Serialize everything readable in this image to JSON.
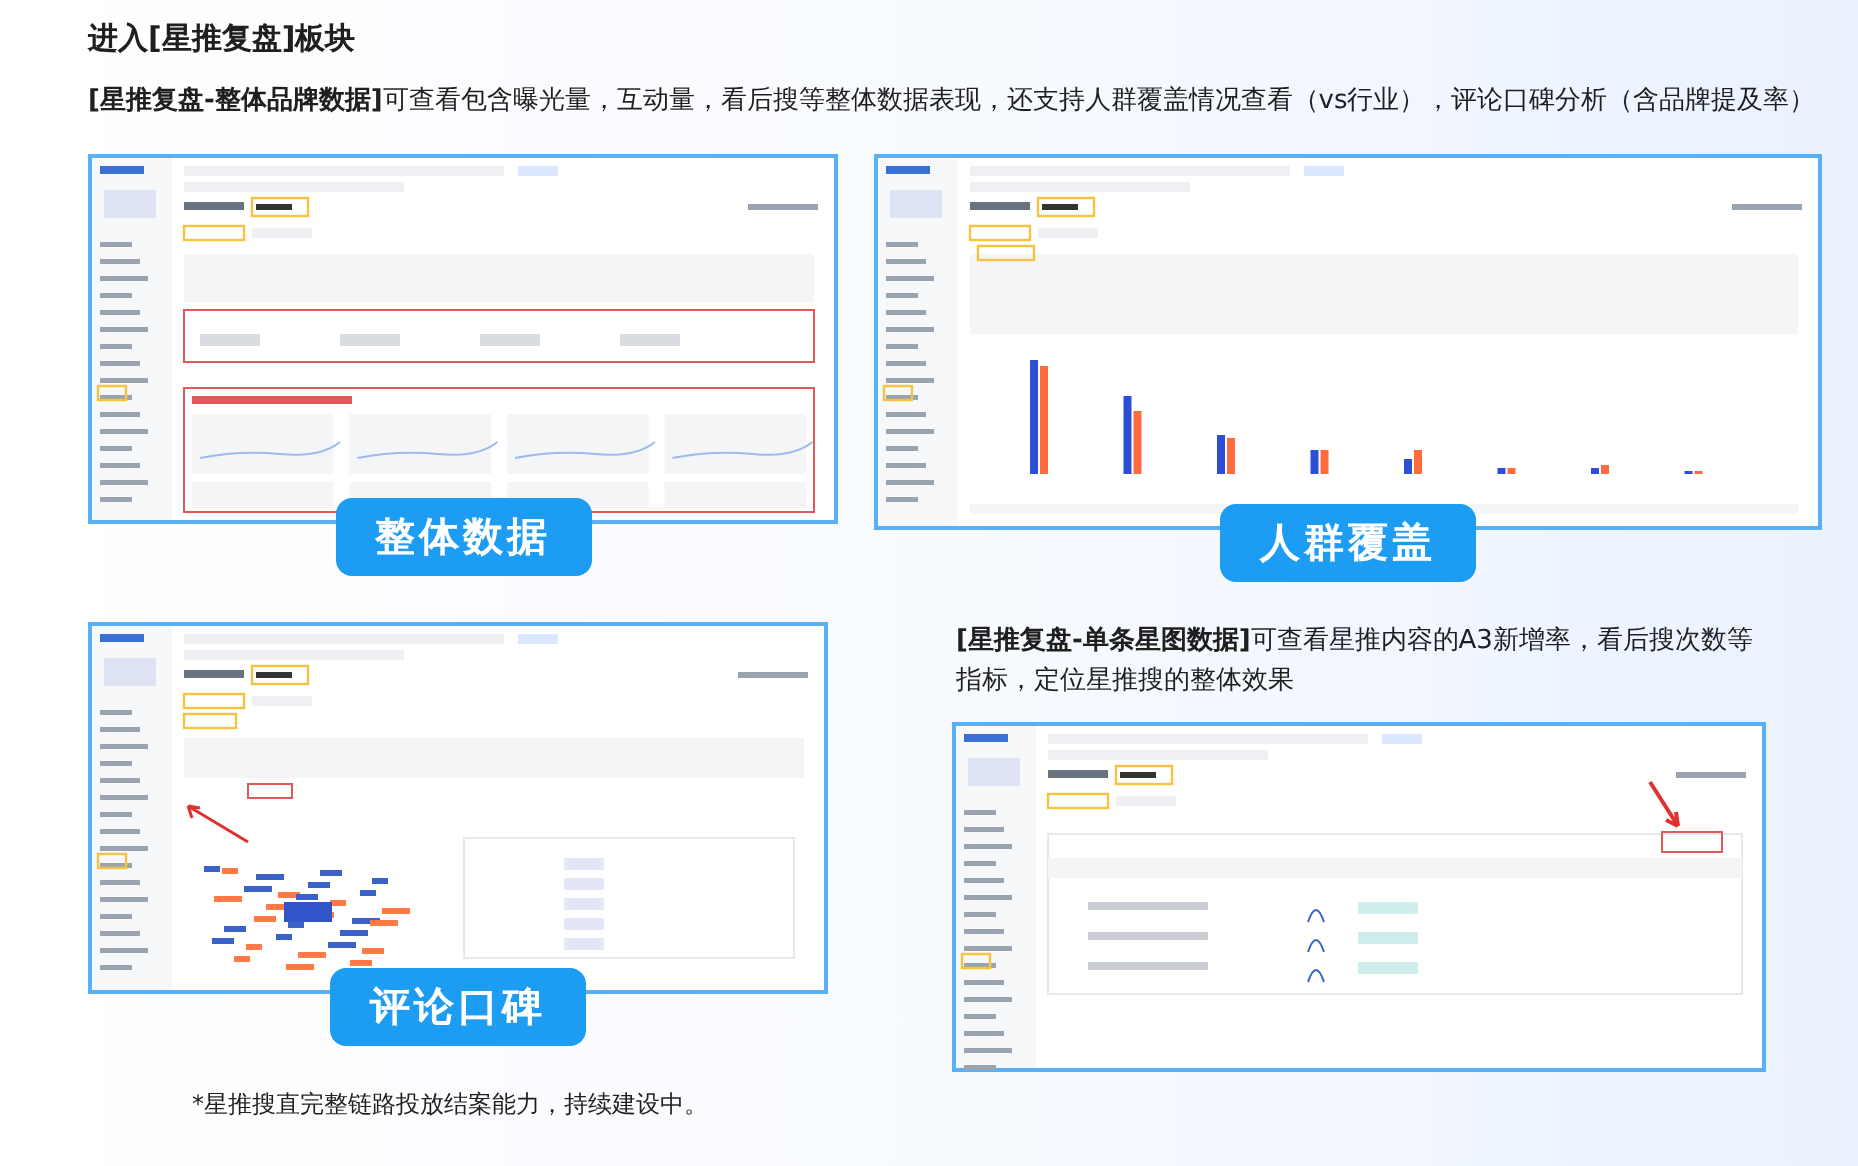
{
  "heading": "进入[星推复盘]板块",
  "intro": "**[星推复盘-整体品牌数据]**可查看包含曝光量，互动量，看后搜等整体数据表现，还支持人群覆盖情况查看（vs行业），评论口碑分析（含品牌提及率）",
  "panels": [
    {
      "kind": "overview",
      "caption": "整体数据"
    },
    {
      "kind": "audience",
      "caption": "人群覆盖"
    },
    {
      "kind": "reviews",
      "caption": "评论口碑"
    },
    {
      "kind": "single"
    }
  ],
  "single_view_note": "**[星推复盘-单条星图数据]**可查看星推内容的A3新增率，看后搜次数等指标，定位星推搜的整体效果",
  "footnote": "*星推搜直完整链路投放结案能力，持续建设中。"
}
